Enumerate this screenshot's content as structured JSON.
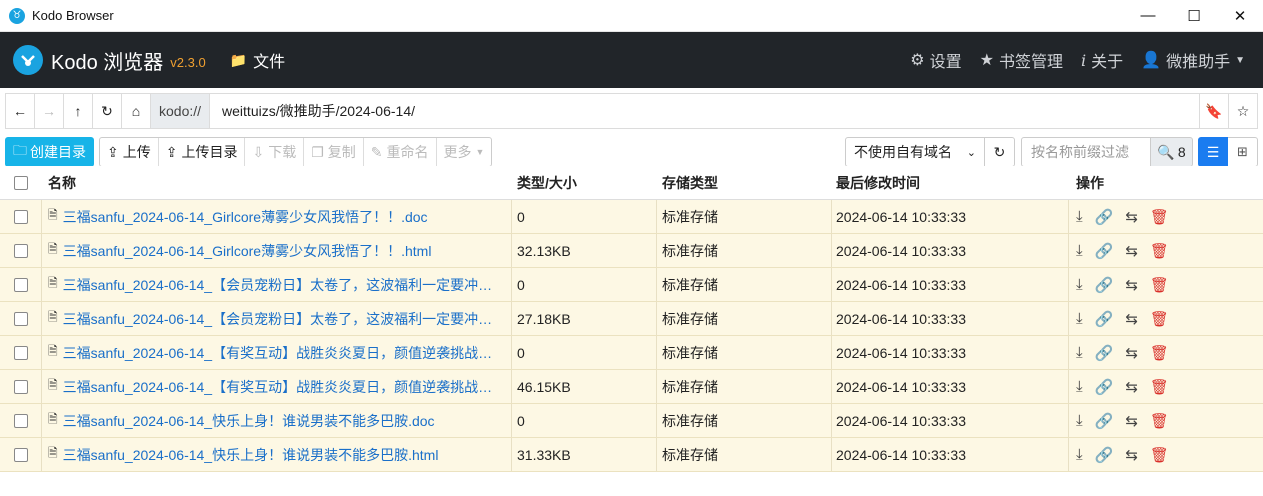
{
  "window": {
    "title": "Kodo Browser",
    "controls": {
      "minimize": "—",
      "maximize": "☐",
      "close": "✕"
    }
  },
  "navbar": {
    "brand": "Kodo 浏览器",
    "version": "v2.3.0",
    "files_label": "文件",
    "settings_label": "设置",
    "bookmarks_label": "书签管理",
    "about_label": "关于",
    "user_label": "微推助手"
  },
  "address": {
    "protocol": "kodo://",
    "path": "weittuizs/微推助手/2024-06-14/"
  },
  "toolbar": {
    "create_dir": "创建目录",
    "upload": "上传",
    "upload_dir": "上传目录",
    "download": "下载",
    "copy": "复制",
    "rename": "重命名",
    "more": "更多",
    "domain_select": "不使用自有域名",
    "filter_placeholder": "按名称前缀过滤",
    "result_count": "8"
  },
  "table": {
    "headers": {
      "name": "名称",
      "type_size": "类型/大小",
      "storage": "存储类型",
      "modified": "最后修改时间",
      "ops": "操作"
    },
    "rows": [
      {
        "name": "三福sanfu_2024-06-14_Girlcore薄雾少女风我悟了！！.doc",
        "size": "0",
        "storage": "标准存储",
        "modified": "2024-06-14 10:33:33"
      },
      {
        "name": "三福sanfu_2024-06-14_Girlcore薄雾少女风我悟了！！.html",
        "size": "32.13KB",
        "storage": "标准存储",
        "modified": "2024-06-14 10:33:33"
      },
      {
        "name": "三福sanfu_2024-06-14_【会员宠粉日】太卷了，这波福利一定要冲…",
        "size": "0",
        "storage": "标准存储",
        "modified": "2024-06-14 10:33:33"
      },
      {
        "name": "三福sanfu_2024-06-14_【会员宠粉日】太卷了，这波福利一定要冲…",
        "size": "27.18KB",
        "storage": "标准存储",
        "modified": "2024-06-14 10:33:33"
      },
      {
        "name": "三福sanfu_2024-06-14_【有奖互动】战胜炎炎夏日，颜值逆袭挑战…",
        "size": "0",
        "storage": "标准存储",
        "modified": "2024-06-14 10:33:33"
      },
      {
        "name": "三福sanfu_2024-06-14_【有奖互动】战胜炎炎夏日，颜值逆袭挑战…",
        "size": "46.15KB",
        "storage": "标准存储",
        "modified": "2024-06-14 10:33:33"
      },
      {
        "name": "三福sanfu_2024-06-14_快乐上身！谁说男装不能多巴胺.doc",
        "size": "0",
        "storage": "标准存储",
        "modified": "2024-06-14 10:33:33"
      },
      {
        "name": "三福sanfu_2024-06-14_快乐上身！谁说男装不能多巴胺.html",
        "size": "31.33KB",
        "storage": "标准存储",
        "modified": "2024-06-14 10:33:33"
      }
    ]
  },
  "colors": {
    "navbar_bg": "#212529",
    "primary": "#17b4e8",
    "row_bg": "#fdf8e4",
    "link": "#1a6fc9",
    "version": "#f0a030",
    "delete": "#d9302a"
  }
}
